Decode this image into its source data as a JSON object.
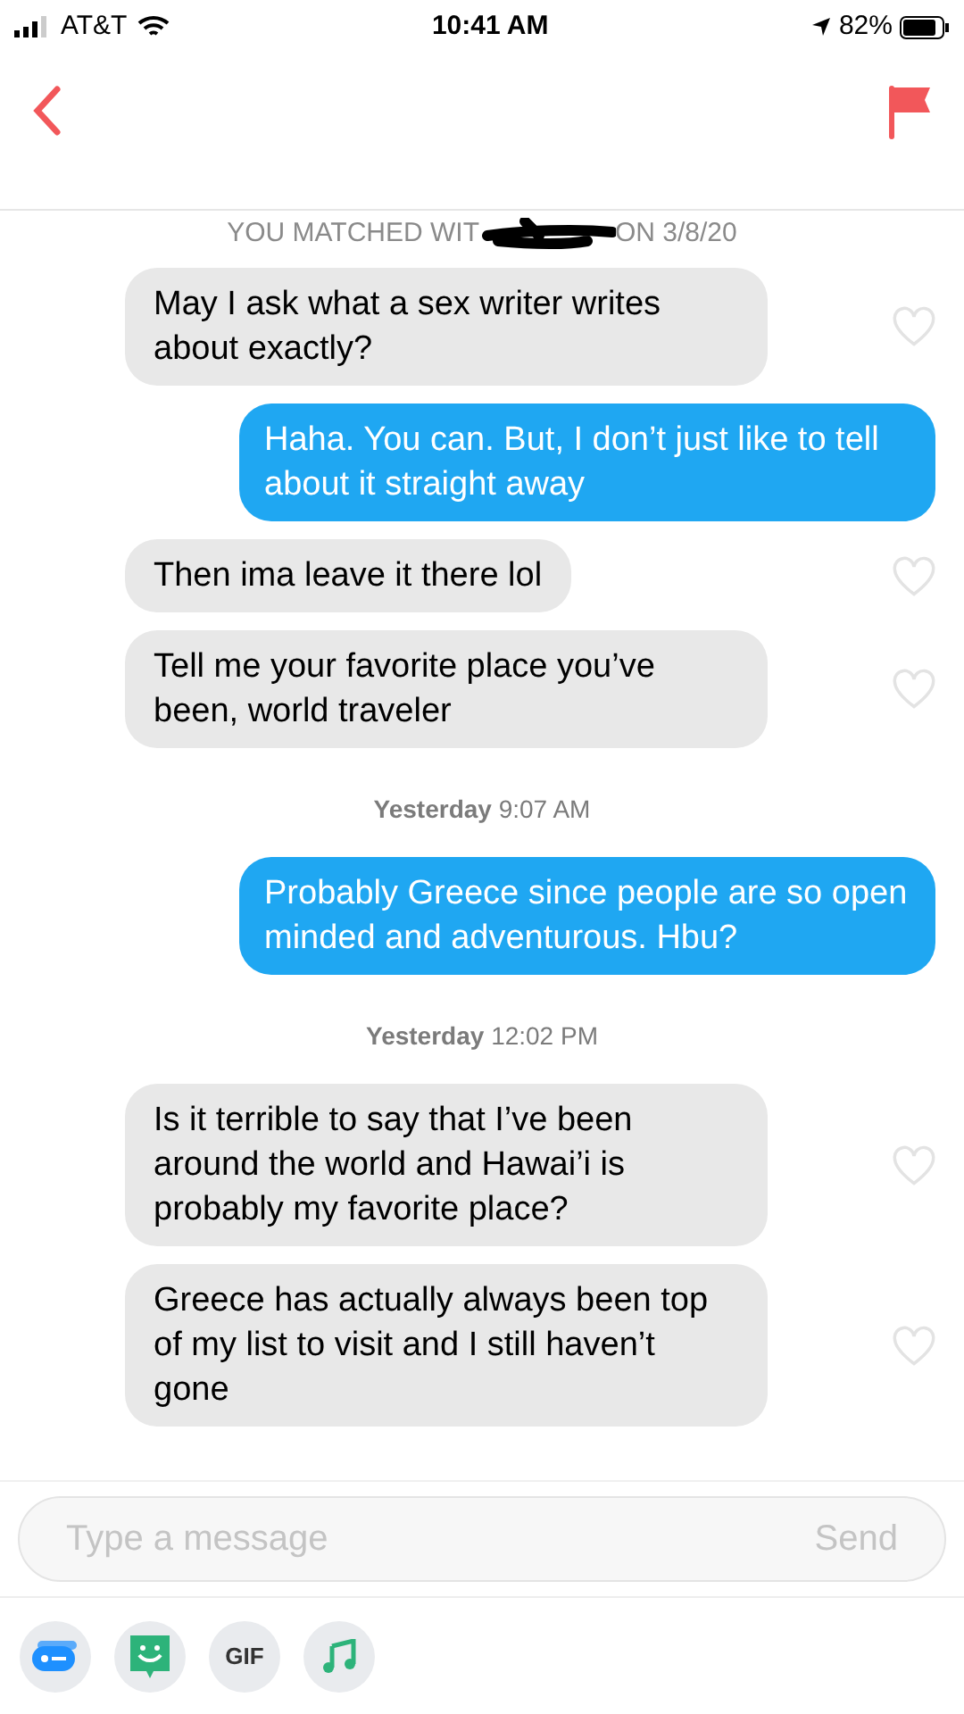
{
  "status_bar": {
    "carrier": "AT&T",
    "time": "10:41 AM",
    "battery": "82%"
  },
  "match_notice": {
    "before": "YOU MATCHED WIT",
    "after": "ON 3/8/20"
  },
  "messages": [
    {
      "kind": "received",
      "text": "May I ask what a sex writer writes about exactly?",
      "liked": false
    },
    {
      "kind": "sent",
      "text": "Haha. You can. But, I don’t just like to tell about it straight away"
    },
    {
      "kind": "received",
      "text": "Then ima leave it there lol",
      "liked": false
    },
    {
      "kind": "received",
      "text": "Tell me your favorite place you’ve been, world traveler",
      "liked": false
    },
    {
      "kind": "timestamp",
      "day": "Yesterday",
      "time": "9:07 AM"
    },
    {
      "kind": "sent",
      "text": "Probably Greece since people are so open minded and adventurous. Hbu?"
    },
    {
      "kind": "timestamp",
      "day": "Yesterday",
      "time": "12:02 PM"
    },
    {
      "kind": "received",
      "text": "Is it terrible to say that I’ve been around the world and Hawai’i is probably my favorite place?",
      "liked": false
    },
    {
      "kind": "received",
      "text": "Greece has actually always been top of my list to visit and I still haven’t gone",
      "liked": false
    }
  ],
  "composer": {
    "placeholder": "Type a message",
    "send": "Send"
  },
  "toolbar": [
    {
      "kind": "card"
    },
    {
      "kind": "sticker"
    },
    {
      "kind": "gif",
      "label": "GIF"
    },
    {
      "kind": "music"
    }
  ]
}
